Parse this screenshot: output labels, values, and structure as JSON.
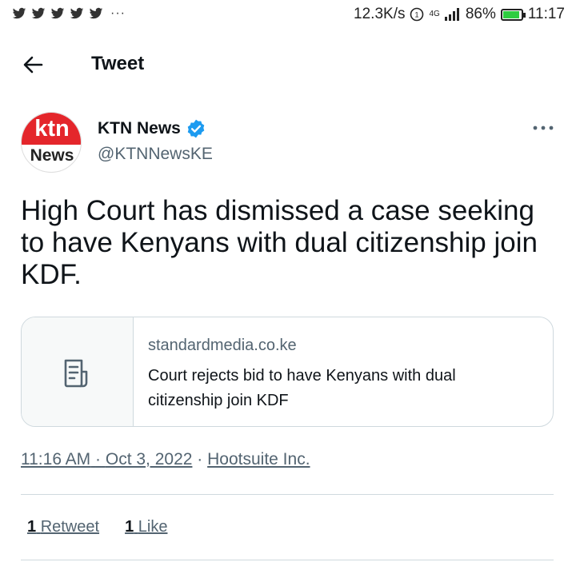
{
  "status_bar": {
    "notification_icons": [
      "twitter-bird-icon",
      "twitter-bird-icon",
      "twitter-bird-icon",
      "twitter-bird-icon",
      "twitter-bird-icon"
    ],
    "more": "···",
    "speed": "12.3K/s",
    "network": "4G",
    "battery": "86%",
    "time": "11:17"
  },
  "header": {
    "title": "Tweet"
  },
  "tweet": {
    "author_name": "KTN News",
    "author_handle": "@KTNNewsKE",
    "avatar_top": "ktn",
    "avatar_bottom": "News",
    "text": "High Court has dismissed a case seeking to have Kenyans with dual citizenship join KDF.",
    "link_card": {
      "domain": "standardmedia.co.ke",
      "title": "Court rejects bid to have Kenyans with dual citizenship join KDF"
    },
    "time": "11:16 AM",
    "date": "Oct 3, 2022",
    "source": "Hootsuite Inc.",
    "separator": "·",
    "retweet_count": "1",
    "retweet_label": "Retweet",
    "like_count": "1",
    "like_label": "Like"
  },
  "colors": {
    "verified": "#1d9bf0",
    "muted": "#536471",
    "brand_red": "#e4262b",
    "battery": "#2ecc40"
  }
}
